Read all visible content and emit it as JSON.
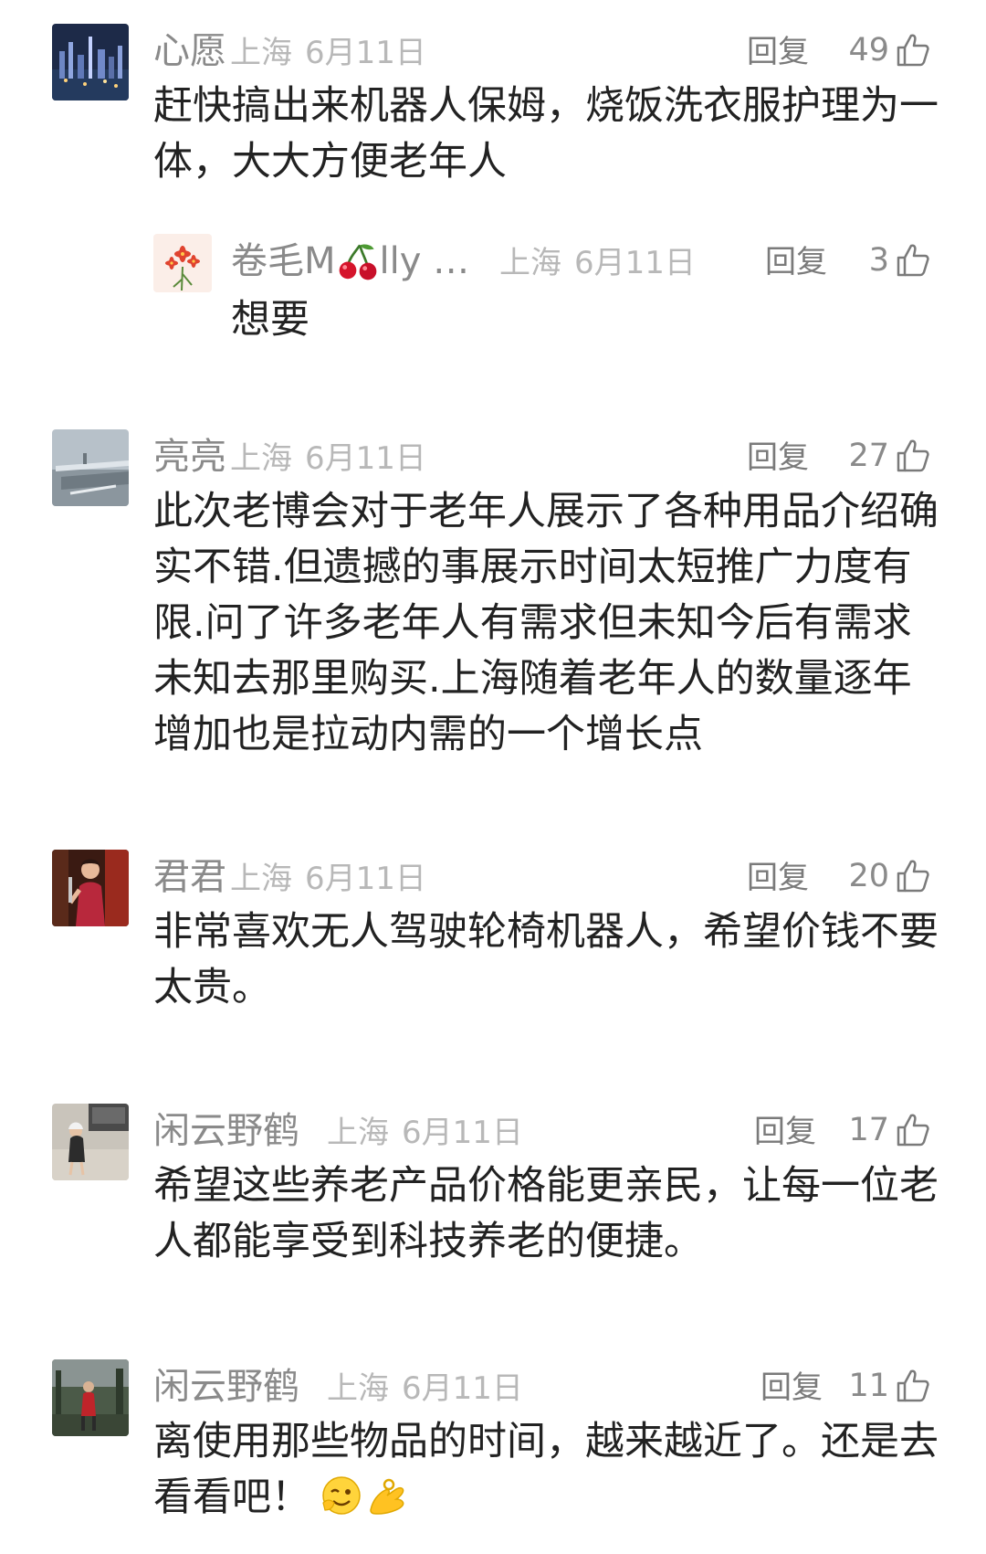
{
  "comments": [
    {
      "username": "心愿",
      "location": "上海",
      "date": "6月11日",
      "reply_label": "回复",
      "likes": "49",
      "text": "赶快搞出来机器人保姆，烧饭洗衣服护理为一体，大大方便老年人",
      "replies": [
        {
          "username_part1": "卷毛M",
          "username_part2": "lly …",
          "location": "上海",
          "date": "6月11日",
          "reply_label": "回复",
          "likes": "3",
          "text": "想要"
        }
      ]
    },
    {
      "username": "亮亮",
      "location": "上海",
      "date": "6月11日",
      "reply_label": "回复",
      "likes": "27",
      "text": "此次老博会对于老年人展示了各种用品介绍确实不错.但遗撼的事展示时间太短推广力度有限.问了许多老年人有需求但未知今后有需求未知去那里购买.上海随着老年人的数量逐年增加也是拉动内需的一个增长点"
    },
    {
      "username": "君君",
      "location": "上海",
      "date": "6月11日",
      "reply_label": "回复",
      "likes": "20",
      "text": "非常喜欢无人驾驶轮椅机器人，希望价钱不要太贵。"
    },
    {
      "username": "闲云野鹤",
      "location": "上海",
      "date": "6月11日",
      "reply_label": "回复",
      "likes": "17",
      "text": "希望这些养老产品价格能更亲民，让每一位老人都能享受到科技养老的便捷。"
    },
    {
      "username": "闲云野鹤",
      "location": "上海",
      "date": "6月11日",
      "reply_label": "回复",
      "likes": "11",
      "text": "离使用那些物品的时间，越来越近了。还是去看看吧！"
    }
  ],
  "icons": {
    "like": "thumbs-up-icon",
    "username_emoji": "cherries-icon",
    "comment_emojis": [
      "wink-face-icon",
      "ok-hand-icon"
    ]
  },
  "colors": {
    "username": "#8a8a8a",
    "meta": "#b8b8b8",
    "body": "#222222"
  }
}
